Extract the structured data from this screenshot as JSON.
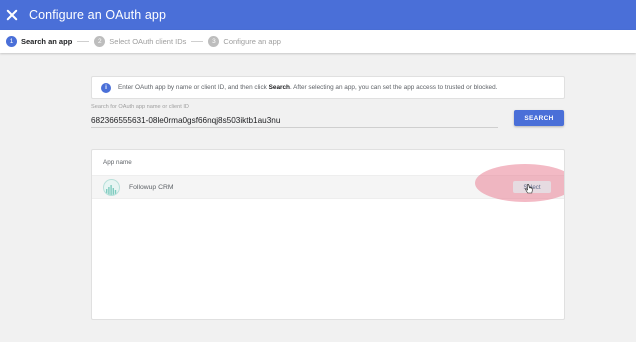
{
  "header": {
    "title": "Configure an OAuth app",
    "close_icon": "close-icon",
    "background": "#4a6fd8"
  },
  "stepper": {
    "steps": [
      {
        "number": "1",
        "label": "Search an app",
        "active": true
      },
      {
        "number": "2",
        "label": "Select OAuth client IDs",
        "active": false
      },
      {
        "number": "3",
        "label": "Configure an app",
        "active": false
      }
    ]
  },
  "info": {
    "icon": "info-icon",
    "icon_text": "i",
    "text_before": "Enter OAuth app by name or client ID, and then click ",
    "text_bold": "Search",
    "text_after": ". After selecting an app, you can set the app access to trusted or blocked."
  },
  "search": {
    "label": "Search for OAuth app name or client ID",
    "value": "682366555631-08le0rma0gsf66nqj8s503iktb1au3nu",
    "button_label": "SEARCH"
  },
  "table": {
    "column_header": "App name",
    "rows": [
      {
        "app_name": "Followup CRM",
        "logo_icon": "followup-crm-logo-icon",
        "action_label": "Select"
      }
    ]
  },
  "colors": {
    "accent": "#4a6fd8",
    "highlight": "#e98296"
  }
}
